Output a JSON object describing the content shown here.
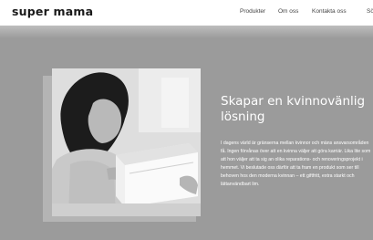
{
  "brand": {
    "logo": "super mama"
  },
  "nav": {
    "items": [
      {
        "label": "Produkter"
      },
      {
        "label": "Om oss"
      },
      {
        "label": "Kontakta oss"
      },
      {
        "label": "Sö"
      }
    ]
  },
  "hero": {
    "title": "Skapar en kvinnovänlig lösning",
    "body": "I dagens värld är gränserna mellan kvinnor och mäns ansvarsområden få. Ingen förvånas över att en kvinna väljer att göra karriär. Lika lite som att hon väljer att ta sig an olika reparations- och renoveringsprojekt i hemmet. Vi beslutade oss därför att ta fram en produkt som ser till behoven hos den moderna kvinnan – ett giftfritt, extra starkt och lättanvändbart lim.",
    "image": "woman-gluing-drawer-photo"
  }
}
